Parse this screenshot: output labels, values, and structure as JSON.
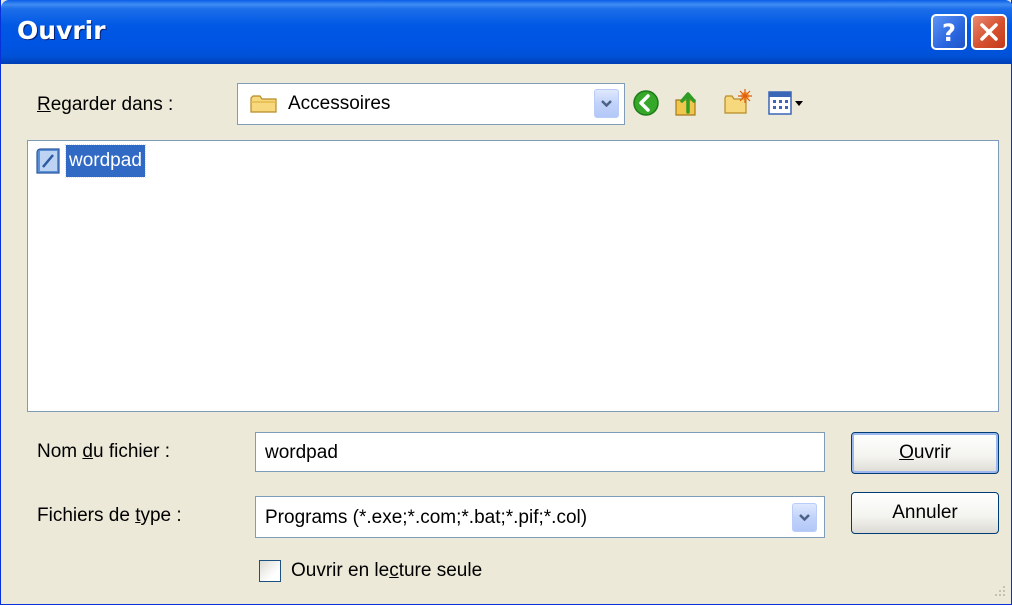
{
  "dialog": {
    "title": "Ouvrir",
    "help_icon": "help-icon",
    "close_icon": "close-icon"
  },
  "look_in": {
    "label_pre": "",
    "label_key": "R",
    "label_post": "egarder dans :",
    "value": "Accessoires",
    "folder_icon": "folder-icon"
  },
  "toolbar": {
    "icons": [
      "back-icon",
      "up-folder-icon",
      "new-folder-icon",
      "view-menu-icon"
    ]
  },
  "files": [
    {
      "name": "wordpad",
      "icon": "wordpad-file-icon",
      "selected": true
    }
  ],
  "file_name": {
    "label_pre": "Nom ",
    "label_key": "d",
    "label_post": "u fichier :",
    "value": "wordpad"
  },
  "file_type": {
    "label_pre": "Fichiers de ",
    "label_key": "t",
    "label_post": "ype :",
    "value": "Programs (*.exe;*.com;*.bat;*.pif;*.col)"
  },
  "read_only": {
    "label_pre": "Ouvrir en le",
    "label_key": "c",
    "label_post": "ture seule",
    "checked": false
  },
  "buttons": {
    "open_key": "O",
    "open_rest": "uvrir",
    "cancel": "Annuler"
  },
  "colors": {
    "titlebar": "#0054e3",
    "selection": "#316ac5",
    "dialog_bg": "#ece9d8"
  }
}
